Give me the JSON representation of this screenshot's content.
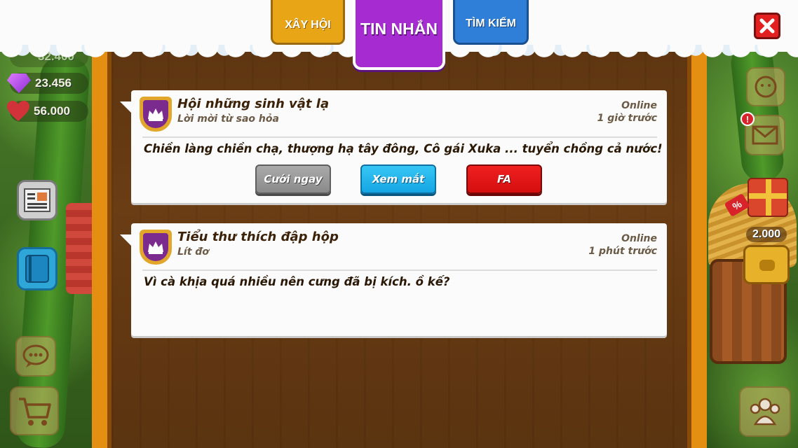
{
  "tabs": [
    {
      "label": "XÂY HỘI",
      "active": false
    },
    {
      "label": "TIN NHẮN",
      "active": true
    },
    {
      "label": "TÌM KIẾM",
      "active": false
    }
  ],
  "resources": {
    "gems": "23.456",
    "hearts": "56.000",
    "coins_partial": "32.400"
  },
  "side": {
    "chest_count": "2.000",
    "alert": "!"
  },
  "messages": [
    {
      "title": "Hội những sinh vật lạ",
      "subtitle": "Lời mời từ sao hỏa",
      "status": "Online",
      "time": "1 giờ trước",
      "body": "Chiền làng chiền chạ, thượng hạ tây đông, Cô gái Xuka ... tuyển chồng cả nước!",
      "actions": [
        "Cưới ngay",
        "Xem mắt",
        "FA"
      ]
    },
    {
      "title": "Tiểu thư thích đập hộp",
      "subtitle": "Lít đơ",
      "status": "Online",
      "time": "1 phút trước",
      "body": "Vì cà khịa quá nhiều nên cưng đã bị kích. ồ kế?"
    }
  ],
  "colors": {
    "panel_wood": "#6a3d14",
    "panel_frame": "#e48f12",
    "tab_active": "#a62bd0",
    "tab_left": "#e8a616",
    "tab_right": "#2f7fd8",
    "close": "#e2201f"
  }
}
